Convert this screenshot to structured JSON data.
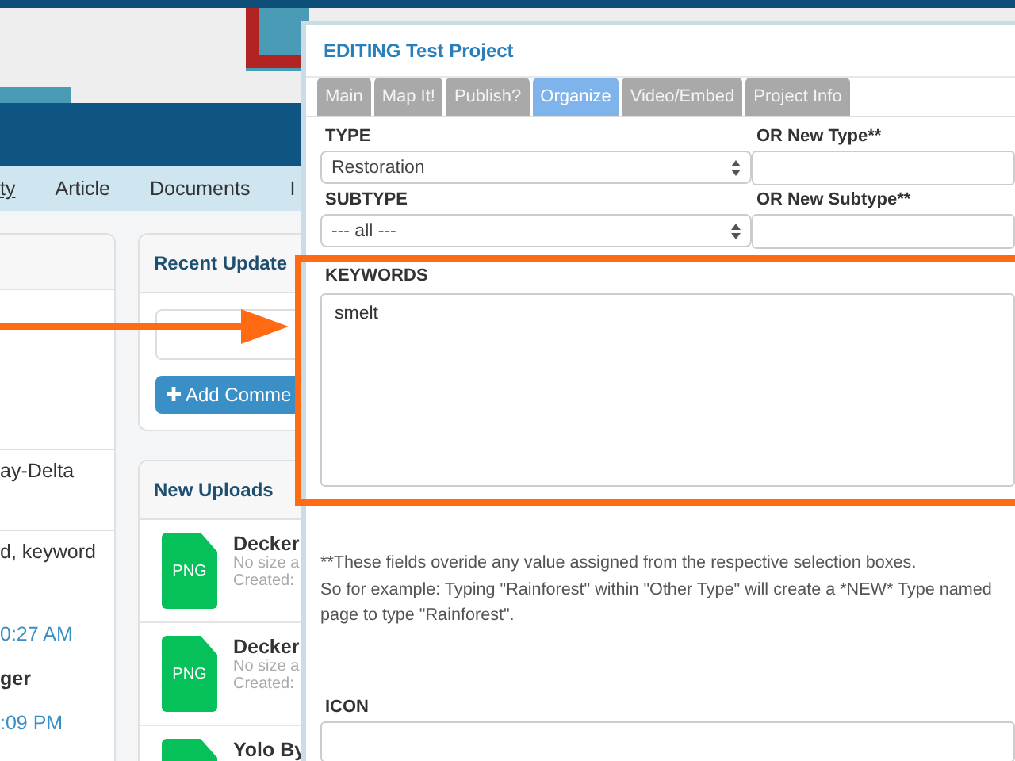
{
  "site_nav": {
    "items": [
      {
        "label": "ty",
        "selected": true
      },
      {
        "label": "Article",
        "selected": false
      },
      {
        "label": "Documents",
        "selected": false
      },
      {
        "label": "I",
        "selected": false
      }
    ]
  },
  "left_panel": {
    "items": [
      {
        "kind": "text",
        "text": "ay-Delta"
      },
      {
        "kind": "text",
        "text": "d, keyword"
      },
      {
        "kind": "time",
        "text": "0:27 AM"
      },
      {
        "kind": "name",
        "text": "ger"
      },
      {
        "kind": "time",
        "text": ":09 PM"
      }
    ]
  },
  "recent_updates": {
    "title": "Recent Update",
    "button": "Add Comme"
  },
  "new_uploads": {
    "title": "New Uploads",
    "files": [
      {
        "badge": "PNG",
        "name": "Decker",
        "size": "No size a",
        "created": "Created:"
      },
      {
        "badge": "PNG",
        "name": "Decker",
        "size": "No size a",
        "created": "Created:"
      },
      {
        "name": "Yolo By"
      }
    ]
  },
  "modal": {
    "title": "EDITING Test Project",
    "tabs": [
      {
        "label": "Main",
        "selected": false
      },
      {
        "label": "Map It!",
        "selected": false
      },
      {
        "label": "Publish?",
        "selected": false
      },
      {
        "label": "Organize",
        "selected": true
      },
      {
        "label": "Video/Embed",
        "selected": false
      },
      {
        "label": "Project Info",
        "selected": false
      }
    ],
    "type": {
      "label": "TYPE",
      "value": "Restoration"
    },
    "new_type": {
      "label": "OR New Type**"
    },
    "subtype": {
      "label": "SUBTYPE",
      "value": "--- all ---"
    },
    "new_subtype": {
      "label": "OR New Subtype**"
    },
    "keywords": {
      "label": "KEYWORDS",
      "value": "smelt"
    },
    "note": [
      "**These fields overide any value assigned from the respective selection boxes.",
      "So for example: Typing \"Rainforest\" within \"Other Type\" will create a *NEW* Type named",
      "page to type \"Rainforest\"."
    ],
    "icon": {
      "label": "ICON"
    }
  }
}
